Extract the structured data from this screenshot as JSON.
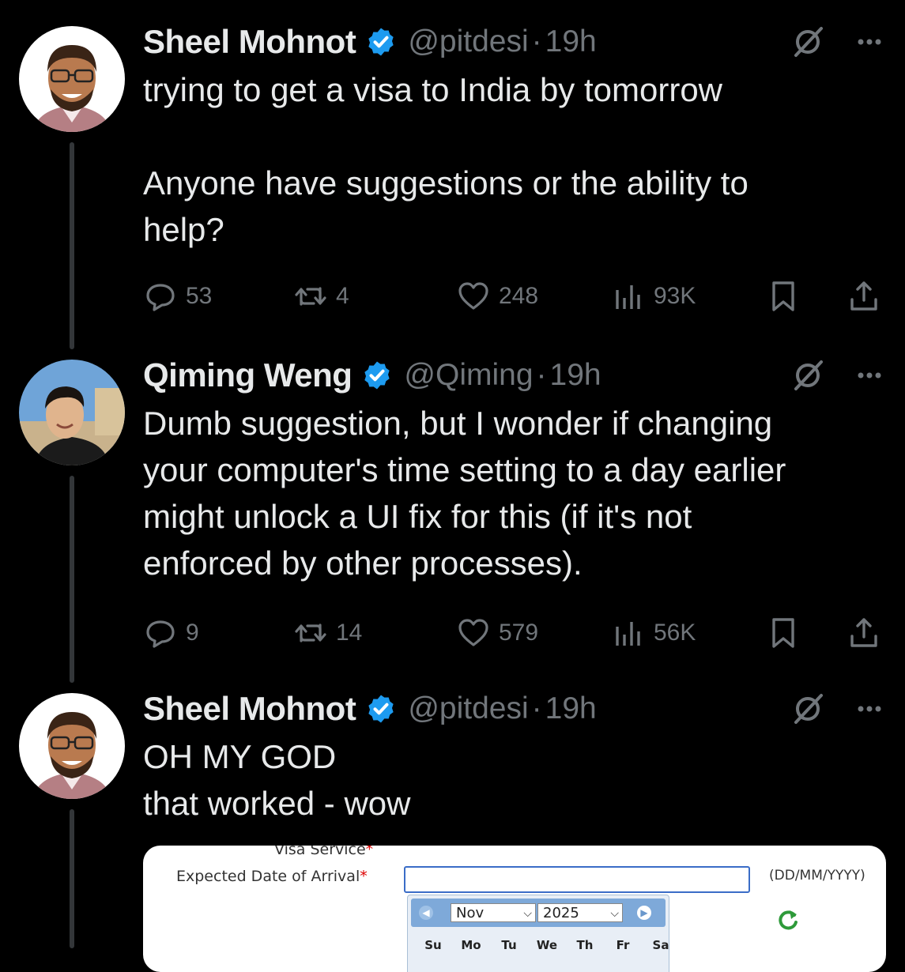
{
  "tweets": [
    {
      "name": "Sheel Mohnot",
      "handle": "@pitdesi",
      "dot": "·",
      "time": "19h",
      "lines": [
        "trying to get a visa to India by tomorrow",
        "",
        "Anyone have suggestions or the ability to",
        "help?"
      ],
      "stats": {
        "replies": "53",
        "reposts": "4",
        "likes": "248",
        "views": "93K"
      }
    },
    {
      "name": "Qiming Weng",
      "handle": "@Qiming",
      "dot": "·",
      "time": "19h",
      "lines": [
        "Dumb suggestion, but I wonder if changing",
        "your computer's time setting to a day earlier",
        "might unlock a UI fix for this (if it's not",
        "enforced by other processes)."
      ],
      "stats": {
        "replies": "9",
        "reposts": "14",
        "likes": "579",
        "views": "56K"
      }
    },
    {
      "name": "Sheel Mohnot",
      "handle": "@pitdesi",
      "dot": "·",
      "time": "19h",
      "lines": [
        "OH MY GOD",
        "that worked - wow"
      ]
    }
  ],
  "embedded_screenshot": {
    "cut_label": "Visa Service",
    "required_mark": "*",
    "field_label": "Expected Date of Arrival",
    "format_hint": "(DD/MM/YYYY)",
    "month": "Nov",
    "year": "2025",
    "weekdays": [
      "Su",
      "Mo",
      "Tu",
      "We",
      "Th",
      "Fr",
      "Sa"
    ]
  },
  "colors": {
    "background": "#000000",
    "text": "#e7e9ea",
    "muted": "#71767b",
    "verified": "#1d9bf0",
    "thread_line": "#333639"
  }
}
